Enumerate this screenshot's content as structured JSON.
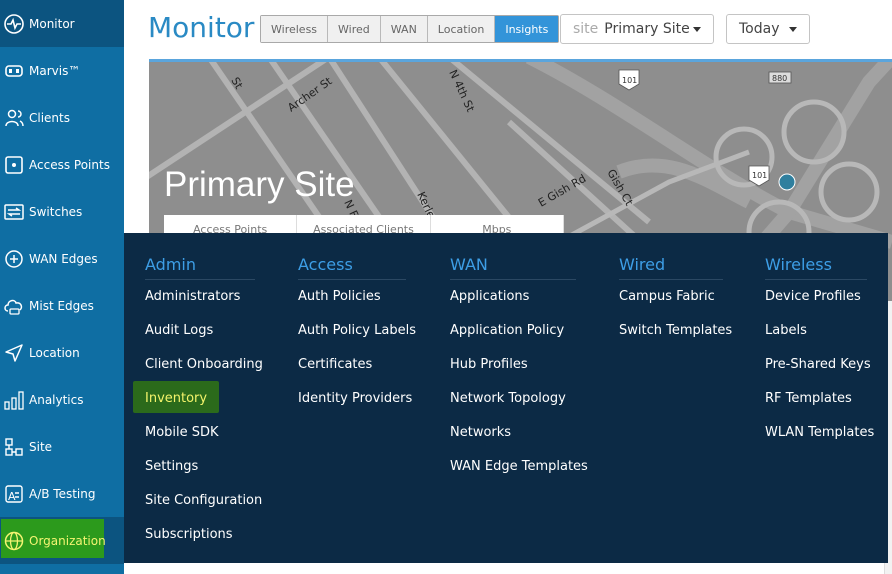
{
  "sidebar": {
    "items": [
      {
        "label": "Monitor",
        "icon": "monitor-icon"
      },
      {
        "label": "Marvis™",
        "icon": "marvis-icon"
      },
      {
        "label": "Clients",
        "icon": "clients-icon"
      },
      {
        "label": "Access Points",
        "icon": "access-point-icon"
      },
      {
        "label": "Switches",
        "icon": "switches-icon"
      },
      {
        "label": "WAN Edges",
        "icon": "wan-edges-icon"
      },
      {
        "label": "Mist Edges",
        "icon": "mist-edges-icon"
      },
      {
        "label": "Location",
        "icon": "location-icon"
      },
      {
        "label": "Analytics",
        "icon": "analytics-icon"
      },
      {
        "label": "Site",
        "icon": "site-icon"
      },
      {
        "label": "A/B Testing",
        "icon": "ab-testing-icon"
      },
      {
        "label": "Organization",
        "icon": "organization-icon"
      }
    ]
  },
  "header": {
    "title": "Monitor",
    "tabs": [
      "Wireless",
      "Wired",
      "WAN",
      "Location",
      "Insights"
    ],
    "active_tab": "Insights",
    "site_prefix": "site",
    "site_value": "Primary Site",
    "date_value": "Today"
  },
  "map": {
    "site_name": "Primary Site",
    "street_labels": [
      "St",
      "Archer St",
      "N 4th St",
      "101",
      "880",
      "N F",
      "Kerle",
      "E Gish Rd",
      "Gish Ct",
      "101"
    ],
    "stat_tabs": [
      "Access Points",
      "Associated Clients",
      "Mbps"
    ]
  },
  "menu": {
    "columns": [
      {
        "title": "Admin",
        "items": [
          "Administrators",
          "Audit Logs",
          "Client Onboarding",
          "Inventory",
          "Mobile SDK",
          "Settings",
          "Site Configuration",
          "Subscriptions"
        ]
      },
      {
        "title": "Access",
        "items": [
          "Auth Policies",
          "Auth Policy Labels",
          "Certificates",
          "Identity Providers"
        ]
      },
      {
        "title": "WAN",
        "items": [
          "Applications",
          "Application Policy",
          "Hub Profiles",
          "Network Topology",
          "Networks",
          "WAN Edge Templates"
        ]
      },
      {
        "title": "Wired",
        "items": [
          "Campus Fabric",
          "Switch Templates"
        ]
      },
      {
        "title": "Wireless",
        "items": [
          "Device Profiles",
          "Labels",
          "Pre-Shared Keys",
          "RF Templates",
          "WLAN Templates"
        ]
      }
    ],
    "highlighted_item": "Inventory"
  },
  "colors": {
    "sidebar_bg": "#0f6ea3",
    "menu_bg": "#0c2a45",
    "accent": "#3394d9",
    "highlight": "#2b6a1b"
  }
}
